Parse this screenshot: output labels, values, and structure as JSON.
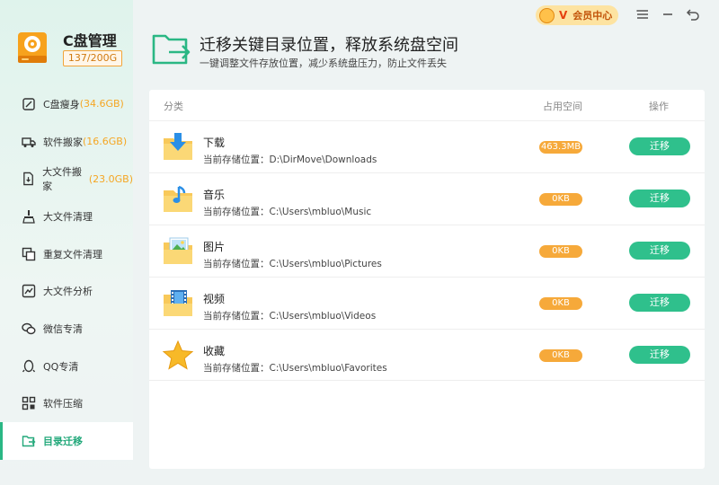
{
  "app": {
    "title": "C盘管理",
    "capacity": "137/200G"
  },
  "topbar": {
    "vip_badge": "V",
    "vip_label": "会员中心",
    "menu_icon": "menu-icon",
    "minimize_icon": "minimize-icon",
    "back_icon": "back-icon"
  },
  "sidebar": {
    "items": [
      {
        "label": "C盘瘦身",
        "size": "(34.6GB)",
        "icon": "broom-icon"
      },
      {
        "label": "软件搬家",
        "size": "(16.6GB)",
        "icon": "truck-icon"
      },
      {
        "label": "大文件搬家",
        "size": "(23.0GB)",
        "icon": "big-file-move-icon"
      },
      {
        "label": "大文件清理",
        "size": "",
        "icon": "brush-icon"
      },
      {
        "label": "重复文件清理",
        "size": "",
        "icon": "duplicate-icon"
      },
      {
        "label": "大文件分析",
        "size": "",
        "icon": "analysis-icon"
      },
      {
        "label": "微信专清",
        "size": "",
        "icon": "wechat-icon"
      },
      {
        "label": "QQ专清",
        "size": "",
        "icon": "qq-icon"
      },
      {
        "label": "软件压缩",
        "size": "",
        "icon": "compress-icon"
      },
      {
        "label": "目录迁移",
        "size": "",
        "icon": "folder-export-icon"
      }
    ],
    "active_index": 9
  },
  "header": {
    "title": "迁移关键目录位置，释放系统盘空间",
    "subtitle": "一键调整文件存放位置，减少系统盘压力，防止文件丢失"
  },
  "table": {
    "columns": {
      "category": "分类",
      "space": "占用空间",
      "action": "操作"
    },
    "path_prefix": "当前存储位置：",
    "rows": [
      {
        "name": "下载",
        "path": "D:\\DirMove\\Downloads",
        "size": "463.3MB",
        "action": "迁移",
        "icon": "downloads-folder-icon"
      },
      {
        "name": "音乐",
        "path": "C:\\Users\\mbluo\\Music",
        "size": "0KB",
        "action": "迁移",
        "icon": "music-folder-icon"
      },
      {
        "name": "图片",
        "path": "C:\\Users\\mbluo\\Pictures",
        "size": "0KB",
        "action": "迁移",
        "icon": "pictures-folder-icon"
      },
      {
        "name": "视频",
        "path": "C:\\Users\\mbluo\\Videos",
        "size": "0KB",
        "action": "迁移",
        "icon": "videos-folder-icon"
      },
      {
        "name": "收藏",
        "path": "C:\\Users\\mbluo\\Favorites",
        "size": "0KB",
        "action": "迁移",
        "icon": "favorites-star-icon"
      }
    ]
  },
  "colors": {
    "accent_green": "#2fc08c",
    "size_orange": "#f6a93a",
    "sidebar_bg": "#dff3ec"
  }
}
